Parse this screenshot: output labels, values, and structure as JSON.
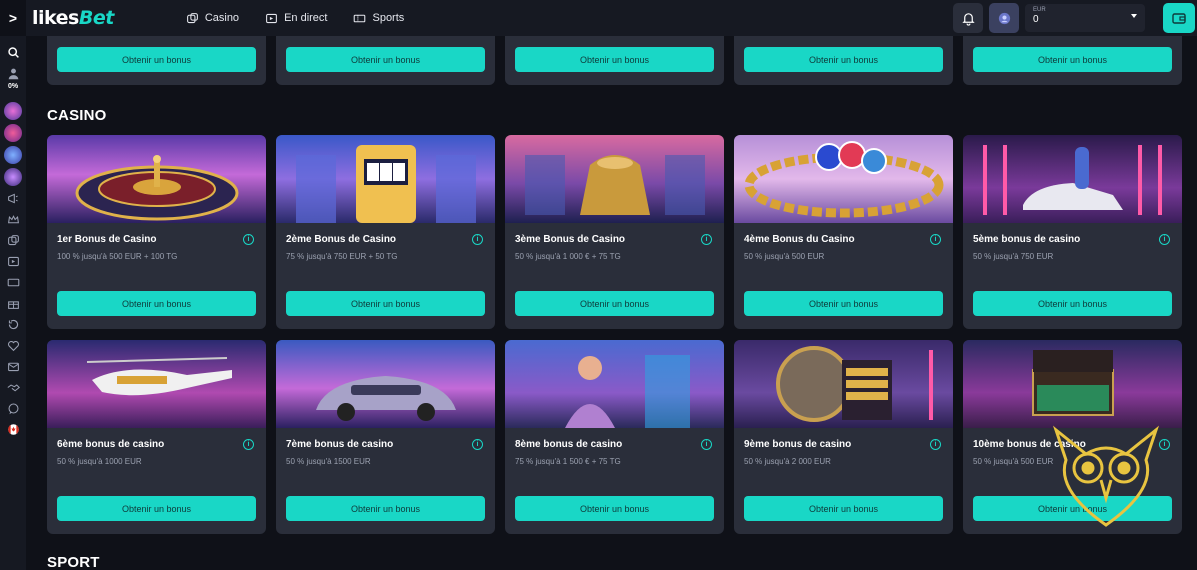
{
  "header": {
    "sidebar_toggle": ">",
    "logo_likes": "likes",
    "logo_bet": "Bet",
    "nav": [
      {
        "label": "Casino",
        "icon": "dice-icon"
      },
      {
        "label": "En direct",
        "icon": "live-icon"
      },
      {
        "label": "Sports",
        "icon": "ticket-icon"
      }
    ],
    "currency": "EUR",
    "balance": "0"
  },
  "sidebar": {
    "percent": "0%",
    "icons": [
      "search-icon",
      "user-icon",
      "megaphone-icon",
      "crown-icon",
      "dice-icon",
      "live-icon",
      "ticket-icon",
      "gift-icon",
      "history-icon",
      "heart-icon",
      "mail-icon",
      "handshake-icon",
      "chat-icon",
      "flag-canada-icon"
    ]
  },
  "top_row": {
    "buttons": [
      "Obtenir un bonus",
      "Obtenir un bonus",
      "Obtenir un bonus",
      "Obtenir un bonus",
      "Obtenir un bonus"
    ]
  },
  "casino": {
    "title": "CASINO",
    "cards": [
      {
        "title": "1er Bonus de Casino",
        "subtitle": "100 % jusqu'à 500 EUR + 100 TG",
        "button": "Obtenir un bonus",
        "image": "roulette-wheel"
      },
      {
        "title": "2ème Bonus de Casino",
        "subtitle": "75 % jusqu'à 750 EUR + 50 TG",
        "button": "Obtenir un bonus",
        "image": "slot-machine"
      },
      {
        "title": "3ème Bonus de Casino",
        "subtitle": "50 % jusqu'à 1 000 € + 75 TG",
        "button": "Obtenir un bonus",
        "image": "gold-money-bag"
      },
      {
        "title": "4ème Bonus du Casino",
        "subtitle": "50 % jusqu'à 500 EUR",
        "button": "Obtenir un bonus",
        "image": "gold-chain-chips"
      },
      {
        "title": "5ème bonus de casino",
        "subtitle": "50 % jusqu'à 750 EUR",
        "button": "Obtenir un bonus",
        "image": "neon-car-person"
      },
      {
        "title": "6ème bonus de casino",
        "subtitle": "50 % jusqu'à 1000 EUR",
        "button": "Obtenir un bonus",
        "image": "helicopter"
      },
      {
        "title": "7ème bonus de casino",
        "subtitle": "50 % jusqu'à 1500 EUR",
        "button": "Obtenir un bonus",
        "image": "luxury-car"
      },
      {
        "title": "8ème bonus de casino",
        "subtitle": "75 % jusqu'à 1 500 € + 75 TG",
        "button": "Obtenir un bonus",
        "image": "woman-casino"
      },
      {
        "title": "9ème bonus de casino",
        "subtitle": "50 % jusqu'à 2 000 EUR",
        "button": "Obtenir un bonus",
        "image": "gold-vault"
      },
      {
        "title": "10ème bonus de casino",
        "subtitle": "50 % jusqu'à 500 EUR",
        "button": "Obtenir un bonus",
        "image": "money-briefcase"
      }
    ]
  },
  "sport": {
    "title": "SPORT"
  },
  "colors": {
    "accent": "#19d7c6",
    "card": "#2a2e3a",
    "background": "#0f1118",
    "topbar": "#161922"
  }
}
